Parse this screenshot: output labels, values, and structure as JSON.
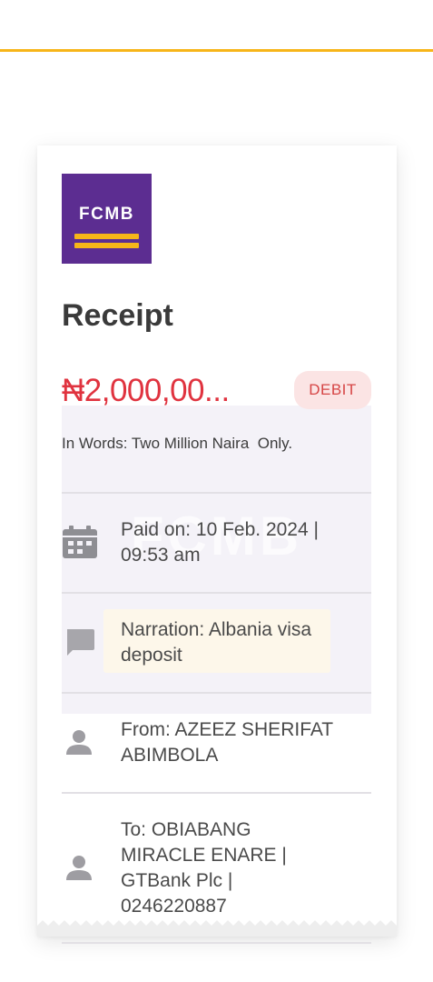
{
  "receipt": {
    "brand": "FCMB",
    "title": "Receipt",
    "amount": "₦2,000,00...",
    "type_badge": "DEBIT",
    "amount_in_words": "In Words: Two Million Naira  Only.",
    "paid_on": "Paid on: 10 Feb. 2024 | 09:53 am",
    "narration": "Narration: Albania visa deposit",
    "from": "From: AZEEZ SHERIFAT ABIMBOLA",
    "to": "To: OBIABANG MIRACLE ENARE | GTBank Plc | 0246220887",
    "watermark": "FCMB"
  },
  "colors": {
    "brand_purple": "#5C2D91",
    "brand_yellow": "#F7B519",
    "amount_red": "#E0333F",
    "badge_bg": "#FBE4E4"
  },
  "icons": {
    "date": "calendar-icon",
    "narration": "chat-bubble-icon",
    "sender": "person-icon",
    "recipient": "person-icon"
  }
}
